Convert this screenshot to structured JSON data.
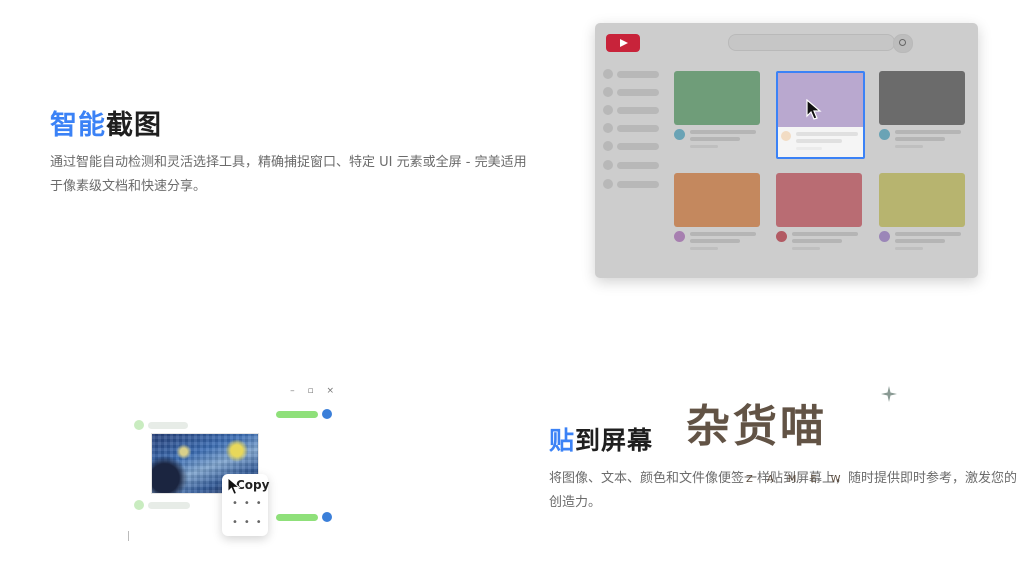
{
  "section_smart_capture": {
    "title_highlight": "智能",
    "title_rest": "截图",
    "description": "通过智能自动检测和灵活选择工具，精确捕捉窗口、特定 UI 元素或全屏 - 完美适用于像素级文档和快速分享。"
  },
  "section_pin": {
    "title_highlight": "贴",
    "title_rest": "到屏幕",
    "description": "将图像、文本、颜色和文件像便签一样贴到屏幕上，随时提供即时参考，激发您的创造力。"
  },
  "pin_mockup": {
    "copy_label": "Copy",
    "window_controls": "– ▫ ×"
  },
  "watermark": {
    "text": "杂货喵",
    "subtext": "ZAMEW"
  },
  "colors": {
    "accent": "#3b82f6",
    "youtube_red": "#c8233a",
    "chat_green": "#8fe07a",
    "avatar_blue": "#3b7fd9"
  },
  "icons": [
    "play-icon",
    "search-icon",
    "cursor-icon",
    "sparkle-icon"
  ]
}
